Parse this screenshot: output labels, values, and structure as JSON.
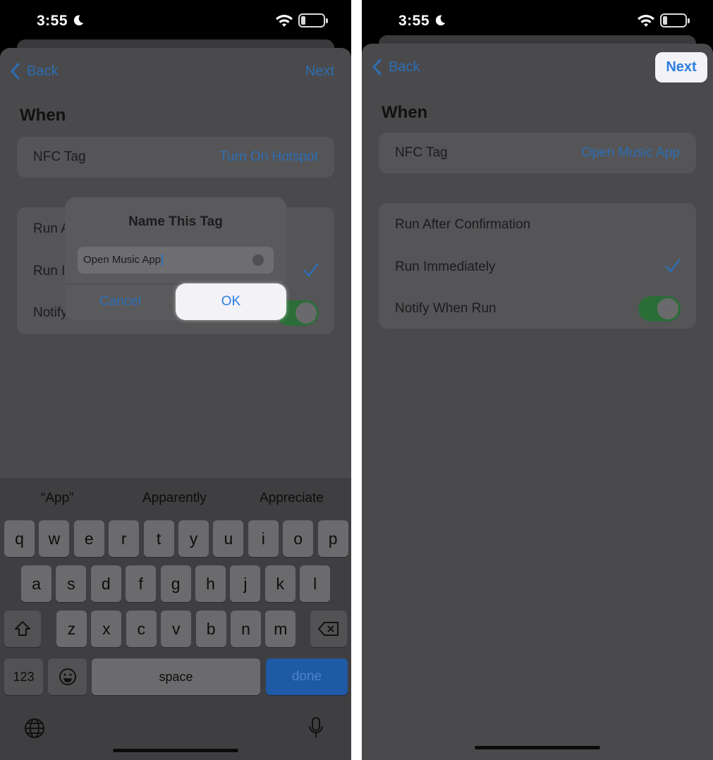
{
  "left": {
    "status": {
      "time": "3:55"
    },
    "nav": {
      "back": "Back",
      "next": "Next"
    },
    "section_title": "When",
    "nfc": {
      "label": "NFC Tag",
      "value": "Turn On Hotspot"
    },
    "options": {
      "run_after": "Run A",
      "run_immediately": "Run I",
      "notify": "Notify"
    },
    "dialog": {
      "title": "Name This Tag",
      "input_value": "Open Music App",
      "cancel": "Cancel",
      "ok": "OK"
    },
    "keyboard": {
      "suggestions": [
        "“App”",
        "Apparently",
        "Appreciate"
      ],
      "row1": [
        "q",
        "w",
        "e",
        "r",
        "t",
        "y",
        "u",
        "i",
        "o",
        "p"
      ],
      "row2": [
        "a",
        "s",
        "d",
        "f",
        "g",
        "h",
        "j",
        "k",
        "l"
      ],
      "row3": [
        "z",
        "x",
        "c",
        "v",
        "b",
        "n",
        "m"
      ],
      "k123": "123",
      "space": "space",
      "done": "done"
    }
  },
  "right": {
    "status": {
      "time": "3:55"
    },
    "nav": {
      "back": "Back",
      "next": "Next"
    },
    "section_title": "When",
    "nfc": {
      "label": "NFC Tag",
      "value": "Open Music App"
    },
    "options": {
      "run_after": "Run After Confirmation",
      "run_immediately": "Run Immediately",
      "notify": "Notify When Run"
    }
  },
  "colors": {
    "accent": "#2d6db4",
    "toggle_on": "#2b6d37",
    "highlight": "#f2f2f7"
  }
}
